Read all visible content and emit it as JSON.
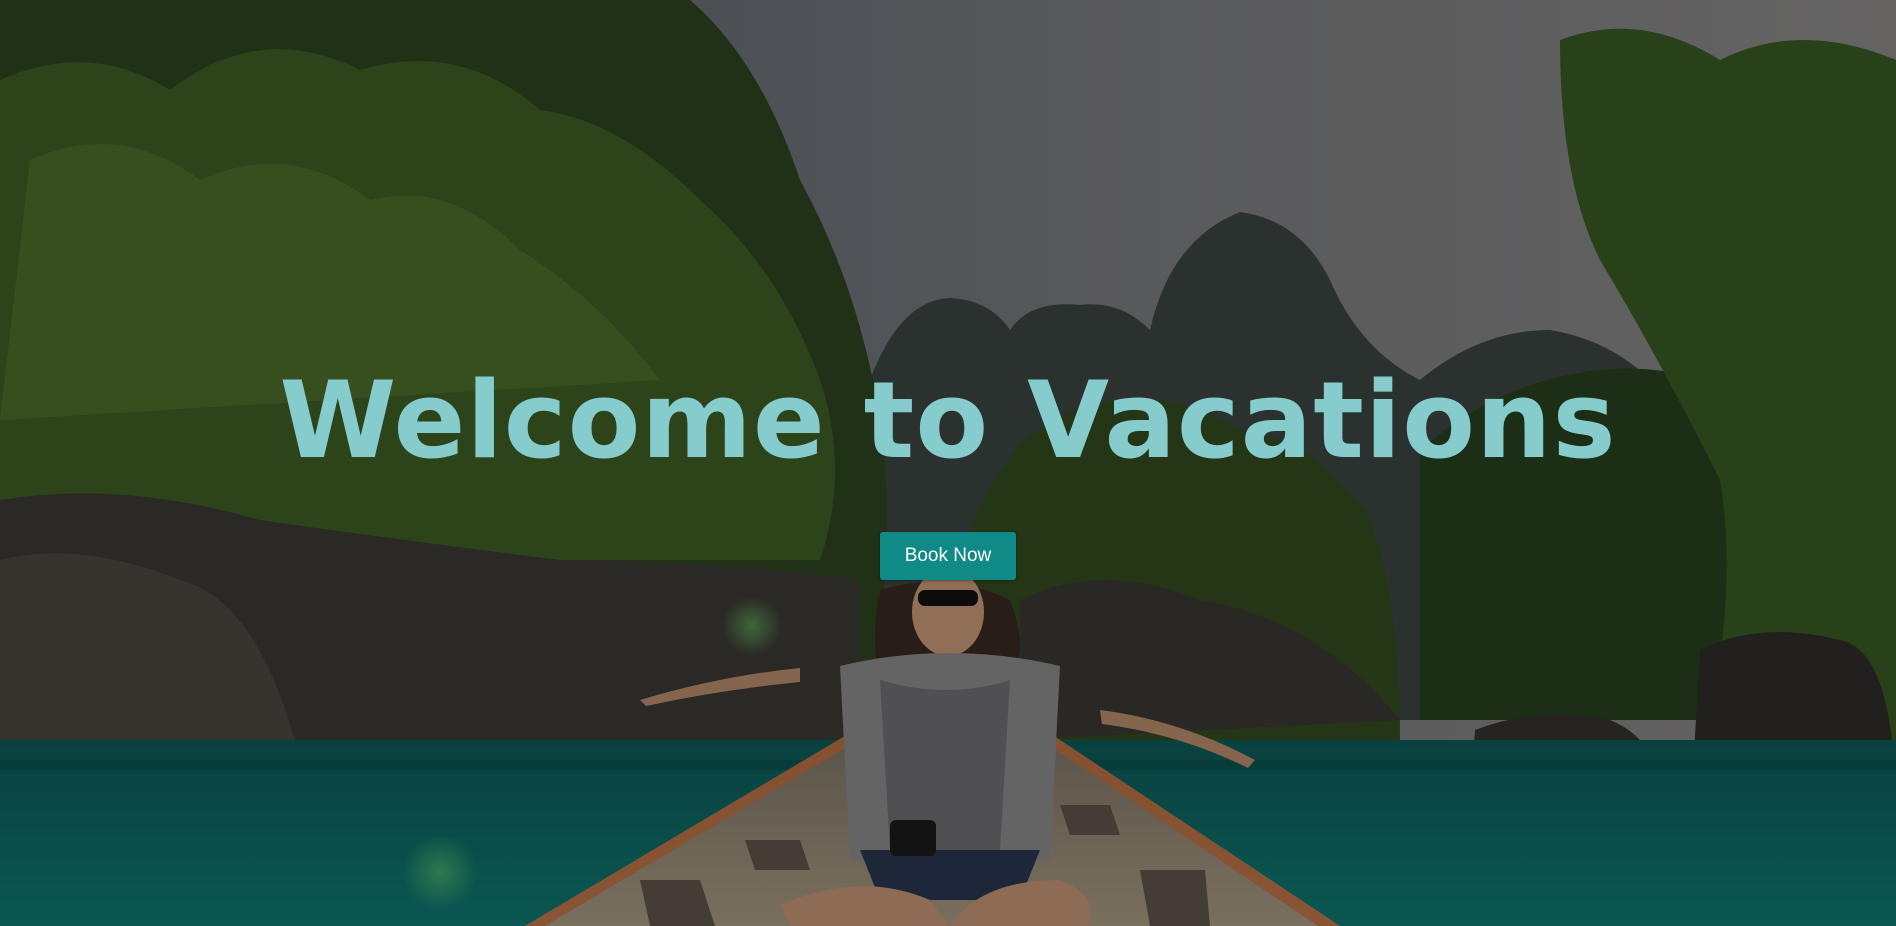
{
  "hero": {
    "title": "Welcome to Vacations",
    "button_label": "Book Now",
    "background_image": "woman-on-longtail-boat-jungle-lagoon",
    "colors": {
      "title": "#86cccc",
      "button": "#0f8a87",
      "water": "#0c6e6a",
      "jungle": "#2f4a1e",
      "sky": "#7a7d80"
    }
  }
}
